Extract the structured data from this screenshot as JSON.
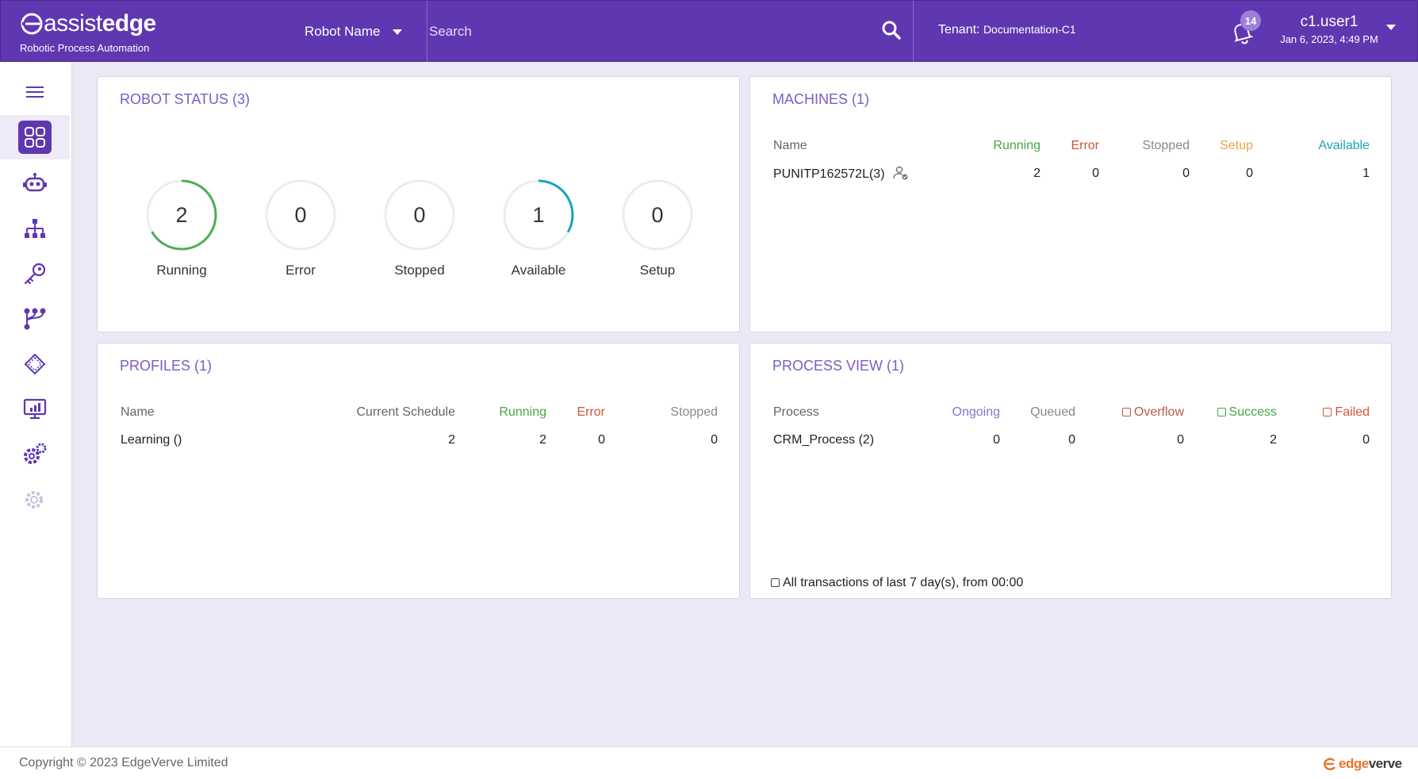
{
  "header": {
    "brand_name_light": "assist",
    "brand_name_bold": "edge",
    "brand_subtitle": "Robotic Process Automation",
    "robot_select_label": "Robot Name",
    "search_placeholder": "Search",
    "tenant_label": "Tenant:",
    "tenant_value": "Documentation-C1",
    "notification_count": "14",
    "user_name": "c1.user1",
    "user_datetime": "Jan 6, 2023, 4:49 PM",
    "colors": {
      "bar": "#5f37b0",
      "text": "#ffffff"
    }
  },
  "sidebar": {
    "items": [
      {
        "icon": "menu-icon"
      },
      {
        "icon": "dashboard-icon",
        "active": true
      },
      {
        "icon": "robot-icon"
      },
      {
        "icon": "hierarchy-icon"
      },
      {
        "icon": "key-icon"
      },
      {
        "icon": "workflow-icon"
      },
      {
        "icon": "chip-icon"
      },
      {
        "icon": "monitor-chart-icon"
      },
      {
        "icon": "settings-icon"
      },
      {
        "icon": "settings-disabled-icon"
      }
    ]
  },
  "robot_status": {
    "title": "ROBOT STATUS (3)",
    "gauges": [
      {
        "label": "Running",
        "value": "2",
        "fraction": 0.667,
        "color": "#4caf50"
      },
      {
        "label": "Error",
        "value": "0",
        "fraction": 0,
        "color": "#d2543a"
      },
      {
        "label": "Stopped",
        "value": "0",
        "fraction": 0,
        "color": "#888888"
      },
      {
        "label": "Available",
        "value": "1",
        "fraction": 0.333,
        "color": "#1ba3b9"
      },
      {
        "label": "Setup",
        "value": "0",
        "fraction": 0,
        "color": "#e2a64c"
      }
    ]
  },
  "machines": {
    "title": "MACHINES (1)",
    "columns": [
      "Name",
      "Running",
      "Error",
      "Stopped",
      "Setup",
      "Available"
    ],
    "rows": [
      {
        "name": "PUNITP162572L(3)",
        "running": "2",
        "error": "0",
        "stopped": "0",
        "setup": "0",
        "available": "1"
      }
    ]
  },
  "profiles": {
    "title": "PROFILES (1)",
    "columns": [
      "Name",
      "Current Schedule",
      "Running",
      "Error",
      "Stopped"
    ],
    "rows": [
      {
        "name": "Learning ()",
        "current_schedule": "2",
        "running": "2",
        "error": "0",
        "stopped": "0"
      }
    ]
  },
  "process_view": {
    "title": "PROCESS VIEW (1)",
    "columns": [
      "Process",
      "Ongoing",
      "Queued",
      "Overflow",
      "Success",
      "Failed"
    ],
    "rows": [
      {
        "process": "CRM_Process (2)",
        "ongoing": "0",
        "queued": "0",
        "overflow": "0",
        "success": "2",
        "failed": "0"
      }
    ],
    "footnote": "All transactions of last 7 day(s), from 00:00"
  },
  "footer": {
    "copyright": "Copyright © 2023 EdgeVerve Limited",
    "logo_text_accent": "edge",
    "logo_text": "verve"
  }
}
